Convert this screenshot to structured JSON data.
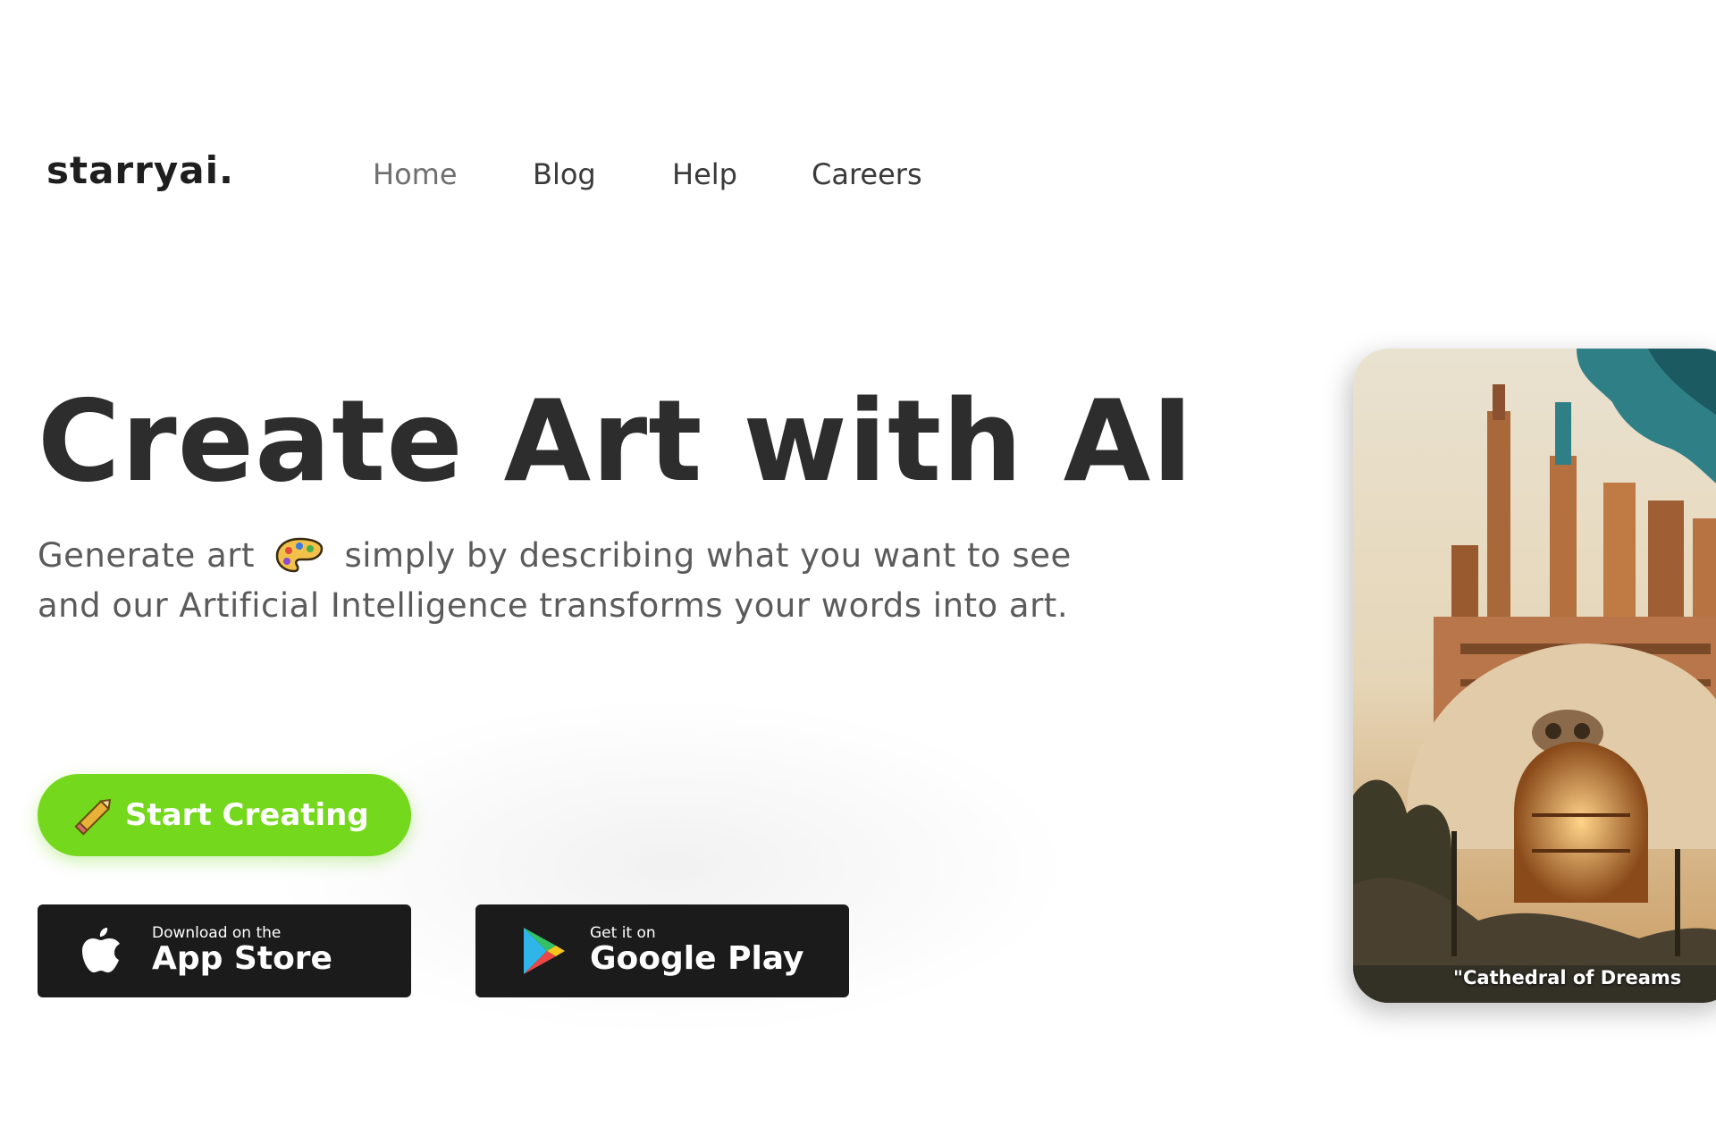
{
  "header": {
    "logo": "starryai.",
    "nav": [
      {
        "label": "Home"
      },
      {
        "label": "Blog"
      },
      {
        "label": "Help"
      },
      {
        "label": "Careers"
      }
    ]
  },
  "hero": {
    "title": "Create Art with AI",
    "subtitle_part1": "Generate art",
    "subtitle_part2": "simply by describing what you want to see",
    "subtitle_line2": "and our Artificial Intelligence transforms your words into art.",
    "start_button": "Start Creating"
  },
  "badges": {
    "apple": {
      "small": "Download on the",
      "big": "App Store"
    },
    "google": {
      "small": "Get it on",
      "big": "Google Play"
    }
  },
  "artwork": {
    "caption": "\"Cathedral of Dreams"
  },
  "colors": {
    "accent_green": "#74d81c",
    "badge_bg": "#1b1b1b",
    "title": "#2d2d2d"
  },
  "icons": [
    "palette-icon",
    "pencil-icon",
    "apple-icon",
    "google-play-icon"
  ]
}
